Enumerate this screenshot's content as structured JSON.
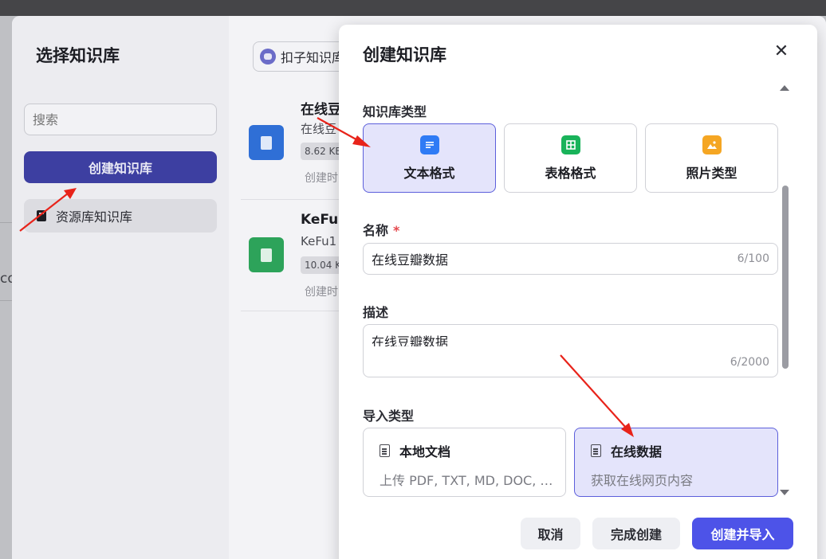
{
  "background": {
    "partial_text": "co"
  },
  "select_modal": {
    "title": "选择知识库",
    "search_placeholder": "搜索",
    "create_button": "创建知识库",
    "repo_item": "资源库知识库",
    "filter_label": "扣子知识库",
    "items": [
      {
        "name": "在线豆",
        "desc": "在线豆",
        "size": "8.62 KB",
        "created": "创建时",
        "thumb_color": "#2f6fd6"
      },
      {
        "name": "KeFu1",
        "desc": "KeFu1",
        "size": "10.04 K",
        "created": "创建时",
        "thumb_color": "#2da35a"
      }
    ]
  },
  "create_dialog": {
    "title": "创建知识库",
    "close_symbol": "✕",
    "kb_type_label": "知识库类型",
    "kb_types": [
      {
        "label": "文本格式",
        "icon": "doc-icon",
        "color": "#2f7bf5",
        "selected": true
      },
      {
        "label": "表格格式",
        "icon": "table-icon",
        "color": "#19b35a",
        "selected": false
      },
      {
        "label": "照片类型",
        "icon": "image-icon",
        "color": "#f5a623",
        "selected": false
      }
    ],
    "name_label": "名称",
    "name_required": "*",
    "name_value": "在线豆瓣数据",
    "name_count": "6/100",
    "desc_label": "描述",
    "desc_value": "在线豆瓣数据",
    "desc_count": "6/2000",
    "import_label": "导入类型",
    "import_types": [
      {
        "title": "本地文档",
        "subtitle": "上传 PDF, TXT, MD, DOC, …",
        "selected": false
      },
      {
        "title": "在线数据",
        "subtitle": "获取在线网页内容",
        "selected": true
      }
    ],
    "buttons": {
      "cancel": "取消",
      "finish": "完成创建",
      "create_import": "创建并导入"
    }
  }
}
